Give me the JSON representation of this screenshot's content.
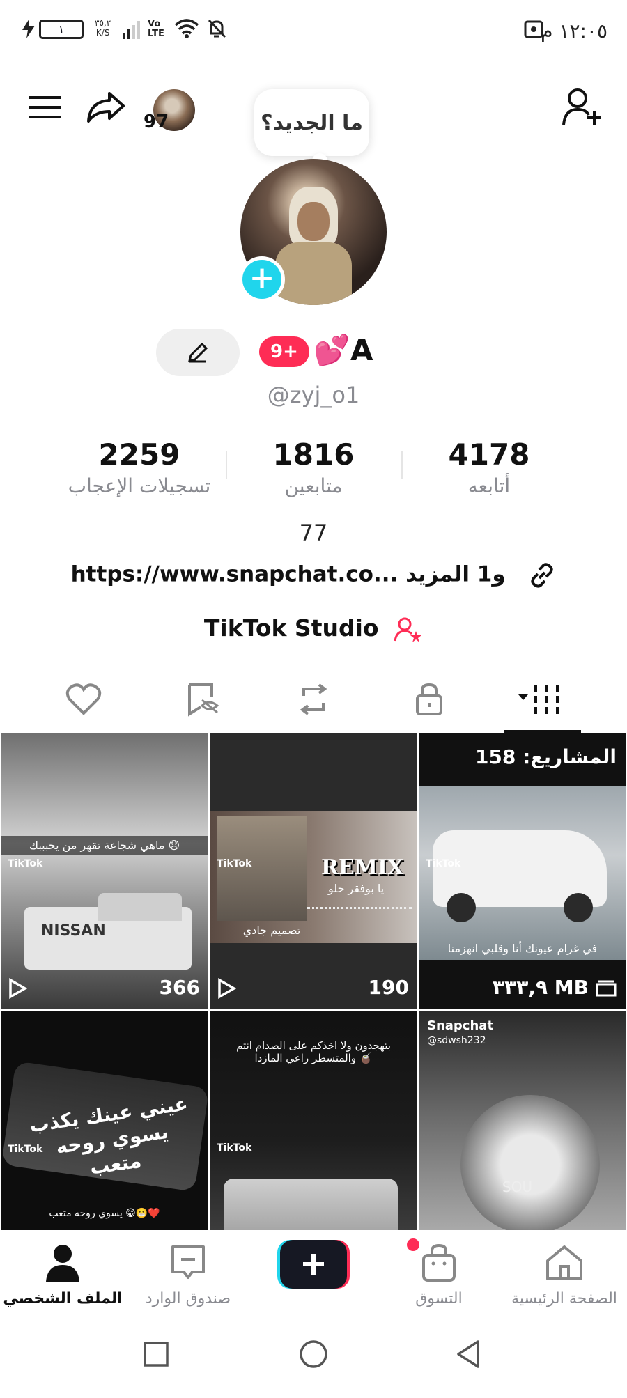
{
  "status_bar": {
    "time": "١٢:٠٥ م",
    "battery": "١",
    "network_speed": "٣٥,٢\nK/S",
    "carrier": "Vo\nLTE"
  },
  "header": {
    "avatar_count": "97",
    "whats_new": "ما الجديد؟"
  },
  "profile": {
    "name": "A",
    "hearts": "💕",
    "badge": "9+",
    "handle": "@zyj_o1",
    "stats": [
      {
        "value": "4178",
        "label": "أتابعه"
      },
      {
        "value": "1816",
        "label": "متابعين"
      },
      {
        "value": "2259",
        "label": "تسجيلات الإعجاب"
      }
    ],
    "bio": "77",
    "link": "https://www.snapchat.co... و1 المزيد",
    "studio": "TikTok Studio"
  },
  "grid": {
    "tiles": [
      {
        "views": "",
        "overlay": "المشاريع: 158",
        "footer": "٣٣٣,٩ MB",
        "caption": "في غرام عيونك أنا وقلبي انهزمنا",
        "tag": "TikTok"
      },
      {
        "views": "190",
        "overlay": "REMIX",
        "subtitle": "يا بوفقر حلو",
        "caption": "تصميم جادي",
        "tag": "TikTok"
      },
      {
        "views": "366",
        "overlay": "NISSAN",
        "caption": "ماهي شجاعة تقهر من يحبببك 😞",
        "tag": "TikTok"
      },
      {
        "views": "",
        "overlay": "Snapchat",
        "subtitle": "@sdwsh232",
        "caption": "SOU",
        "tag": ""
      },
      {
        "views": "",
        "overlay": "",
        "caption": "بتهجدون ولا اخذكم على الصدام انتم والمتسطر راعي المازدا 🧉",
        "tag": "TikTok"
      },
      {
        "views": "",
        "overlay": "عيني عينك يكذب يسوي روحه متعب",
        "caption": "يسوي روحه متعب 😁😬❤️",
        "tag": "TikTok"
      }
    ]
  },
  "bottom_nav": {
    "items": [
      {
        "label": "الصفحة الرئيسية"
      },
      {
        "label": "التسوق"
      },
      {
        "label": "صندوق الوارد"
      },
      {
        "label": "الملف الشخصي"
      }
    ]
  },
  "colors": {
    "accent_red": "#fe2c55",
    "accent_cyan": "#20d5ec",
    "text_muted": "#8a8b91"
  }
}
